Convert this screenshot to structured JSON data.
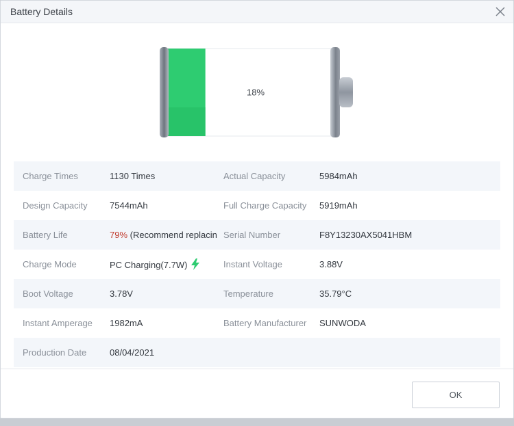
{
  "dialog": {
    "title": "Battery Details",
    "close_icon": "close-icon"
  },
  "battery": {
    "level_fraction": 0.18,
    "level_label": "18%",
    "fill_color": "#2ecc71"
  },
  "rows": [
    {
      "l1": "Charge Times",
      "v1": "1130 Times",
      "l2": "Actual Capacity",
      "v2": "5984mAh"
    },
    {
      "l1": "Design Capacity",
      "v1": "7544mAh",
      "l2": "Full Charge Capacity",
      "v2": "5919mAh"
    },
    {
      "l1": "Battery Life",
      "v1_warn": "79%",
      "v1_rest": " (Recommend replacin",
      "l2": "Serial Number",
      "v2": "F8Y13230AX5041HBM"
    },
    {
      "l1": "Charge Mode",
      "v1": "PC Charging(7.7W)",
      "l2": "Instant Voltage",
      "v2": "3.88V"
    },
    {
      "l1": "Boot Voltage",
      "v1": "3.78V",
      "l2": "Temperature",
      "v2": "35.79°C"
    },
    {
      "l1": "Instant Amperage",
      "v1": "1982mA",
      "l2": "Battery Manufacturer",
      "v2": "SUNWODA"
    },
    {
      "l1": "Production Date",
      "v1": "08/04/2021",
      "l2": "",
      "v2": ""
    }
  ],
  "footer": {
    "ok_label": "OK"
  },
  "colors": {
    "accent_green": "#2ecc71",
    "warning_red": "#c0392b"
  },
  "icons": {
    "charging": "lightning-bolt-icon"
  }
}
